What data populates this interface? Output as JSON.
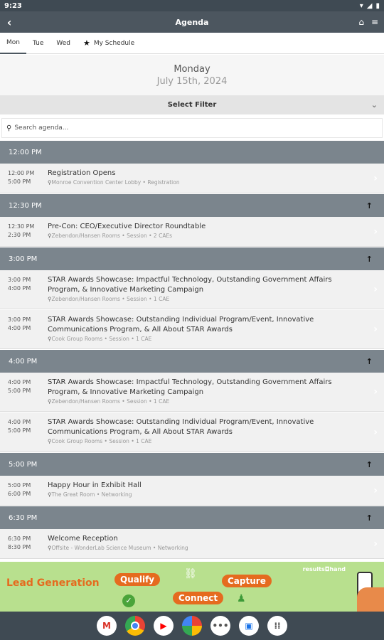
{
  "status": {
    "time": "9:23"
  },
  "header": {
    "title": "Agenda"
  },
  "tabs": [
    "Mon",
    "Tue",
    "Wed",
    "My Schedule"
  ],
  "day_header": {
    "day": "Monday",
    "date": "July 15th, 2024"
  },
  "filter": {
    "label": "Select Filter"
  },
  "search": {
    "placeholder": "Search agenda..."
  },
  "agenda": [
    {
      "time": "12:00 PM",
      "sessions": [
        {
          "start": "12:00 PM",
          "end": "5:00 PM",
          "title": "Registration Opens",
          "meta": "Monroe Convention Center Lobby • Registration"
        }
      ]
    },
    {
      "time": "12:30 PM",
      "sessions": [
        {
          "start": "12:30 PM",
          "end": "2:30 PM",
          "title": "Pre-Con: CEO/Executive Director Roundtable",
          "meta": "Zebendon/Hansen Rooms • Session • 2 CAEs"
        }
      ]
    },
    {
      "time": "3:00 PM",
      "sessions": [
        {
          "start": "3:00 PM",
          "end": "4:00 PM",
          "title": "STAR Awards Showcase: Impactful Technology, Outstanding Government Affairs Program, & Innovative Marketing Campaign",
          "meta": "Zebendon/Hansen Rooms • Session • 1 CAE"
        },
        {
          "start": "3:00 PM",
          "end": "4:00 PM",
          "title": "STAR Awards Showcase: Outstanding Individual Program/Event, Innovative Communications Program, & All About STAR Awards",
          "meta": "Cook Group Rooms • Session • 1 CAE"
        }
      ]
    },
    {
      "time": "4:00 PM",
      "sessions": [
        {
          "start": "4:00 PM",
          "end": "5:00 PM",
          "title": "STAR Awards Showcase: Impactful Technology, Outstanding Government Affairs Program, & Innovative Marketing Campaign",
          "meta": "Zebendon/Hansen Rooms • Session • 1 CAE"
        },
        {
          "start": "4:00 PM",
          "end": "5:00 PM",
          "title": "STAR Awards Showcase: Outstanding Individual Program/Event, Innovative Communications Program, & All About STAR Awards",
          "meta": "Cook Group Rooms • Session • 1 CAE"
        }
      ]
    },
    {
      "time": "5:00 PM",
      "sessions": [
        {
          "start": "5:00 PM",
          "end": "6:00 PM",
          "title": "Happy Hour in Exhibit Hall",
          "meta": "The Great Room • Networking"
        }
      ]
    },
    {
      "time": "6:30 PM",
      "sessions": [
        {
          "start": "6:30 PM",
          "end": "8:30 PM",
          "title": "Welcome Reception",
          "meta": "Offsite - WonderLab Science Museum • Networking"
        }
      ]
    }
  ],
  "banner": {
    "lead": "Lead Generation",
    "qualify": "Qualify",
    "connect": "Connect",
    "capture": "Capture",
    "brand": "results◘hand"
  },
  "colors": {
    "header": "#4c565f",
    "time_band": "#7b858d",
    "row_bg": "#f1f1f1",
    "banner_bg": "#b8e08e",
    "accent": "#e56b1f"
  },
  "nav_icons": [
    "gmail-icon",
    "chrome-icon",
    "youtube-icon",
    "photos-icon",
    "dots-icon",
    "messages-icon",
    "apps-icon"
  ]
}
